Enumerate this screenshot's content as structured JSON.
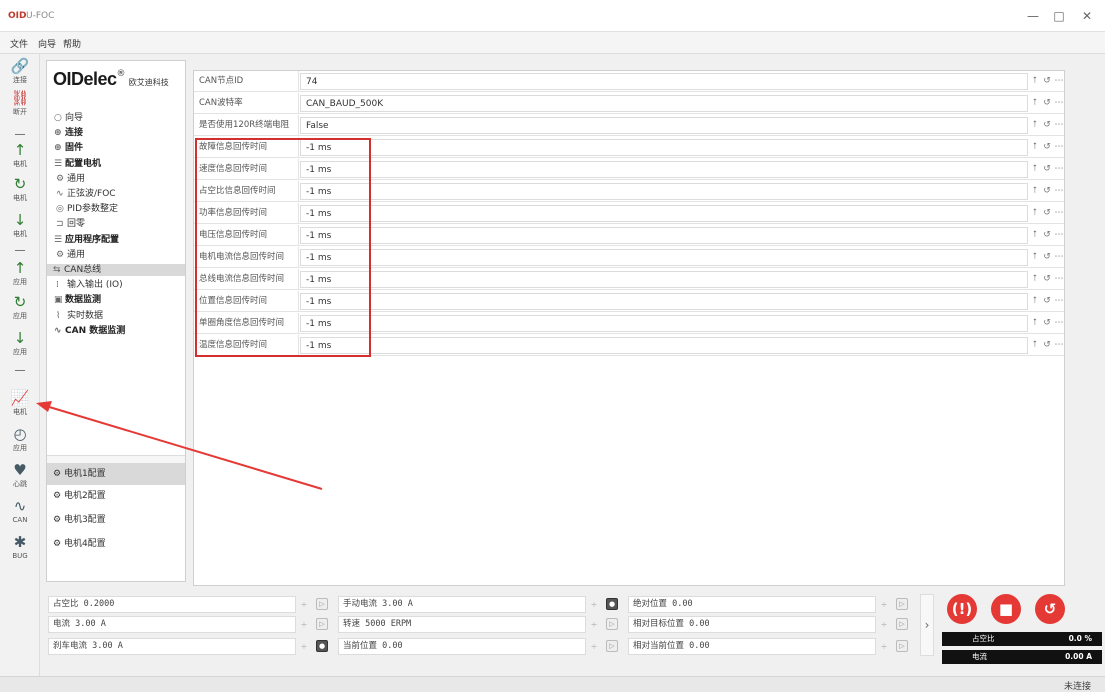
{
  "window": {
    "logo": "OID",
    "title": "U-FOC",
    "minimize": "—",
    "maximize": "□",
    "close": "✕"
  },
  "menu": [
    "文件",
    "向导",
    "帮助"
  ],
  "toolbar": [
    {
      "icon": "link-icon",
      "glyph": "🔗",
      "label": "连接"
    },
    {
      "icon": "unlink-icon",
      "glyph": "⛓",
      "label": "断开"
    },
    {
      "icon": "upload-icon",
      "glyph": "↑",
      "label": "电机"
    },
    {
      "icon": "refresh-icon",
      "glyph": "↻",
      "label": "电机"
    },
    {
      "icon": "download-icon",
      "glyph": "↓",
      "label": "电机"
    },
    {
      "icon": "upload-icon",
      "glyph": "↑",
      "label": "应用"
    },
    {
      "icon": "refresh-icon",
      "glyph": "↻",
      "label": "应用"
    },
    {
      "icon": "download-icon",
      "glyph": "↓",
      "label": "应用"
    },
    {
      "icon": "chart-icon",
      "glyph": "📈",
      "label": "电机"
    },
    {
      "icon": "gauge-icon",
      "glyph": "◴",
      "label": "应用"
    },
    {
      "icon": "heart-icon",
      "glyph": "♥",
      "label": "心跳"
    },
    {
      "icon": "wave-icon",
      "glyph": "∿",
      "label": "CAN"
    },
    {
      "icon": "bug-icon",
      "glyph": "✱",
      "label": "BUG"
    }
  ],
  "brand": {
    "name": "OIDelec",
    "reg": "®",
    "sub": "欧艾迪科技"
  },
  "tree": [
    {
      "label": "向导",
      "icon": "○",
      "bold": false,
      "indent": 0
    },
    {
      "label": "连接",
      "icon": "⊕",
      "bold": true,
      "indent": 0
    },
    {
      "label": "固件",
      "icon": "⊕",
      "bold": true,
      "indent": 0
    },
    {
      "label": "配置电机",
      "icon": "☰",
      "bold": true,
      "indent": 0
    },
    {
      "label": "通用",
      "icon": "⚙",
      "bold": false,
      "indent": 1
    },
    {
      "label": "正弦波/FOC",
      "icon": "∿",
      "bold": false,
      "indent": 1
    },
    {
      "label": "PID参数整定",
      "icon": "◎",
      "bold": false,
      "indent": 1
    },
    {
      "label": "回零",
      "icon": "⊐",
      "bold": false,
      "indent": 1
    },
    {
      "label": "应用程序配置",
      "icon": "☰",
      "bold": true,
      "indent": 0
    },
    {
      "label": "通用",
      "icon": "⚙",
      "bold": false,
      "indent": 1
    },
    {
      "label": "CAN总线",
      "icon": "⇆",
      "bold": false,
      "indent": 1,
      "selected": true
    },
    {
      "label": "输入输出 (IO)",
      "icon": "⁞",
      "bold": false,
      "indent": 1
    },
    {
      "label": "数据监测",
      "icon": "▣",
      "bold": true,
      "indent": 0
    },
    {
      "label": "实时数据",
      "icon": "⌇",
      "bold": false,
      "indent": 1
    },
    {
      "label": "CAN 数据监测",
      "icon": "∿",
      "bold": true,
      "indent": 0
    }
  ],
  "motors": [
    {
      "label": "电机1配置",
      "selected": true
    },
    {
      "label": "电机2配置",
      "selected": false
    },
    {
      "label": "电机3配置",
      "selected": false
    },
    {
      "label": "电机4配置",
      "selected": false
    }
  ],
  "params": [
    {
      "label": "CAN节点ID",
      "value": "74"
    },
    {
      "label": "CAN波特率",
      "value": "CAN_BAUD_500K"
    },
    {
      "label": "是否使用120R终端电阻",
      "value": "False"
    },
    {
      "label": "故障信息回传时间",
      "value": "-1 ms"
    },
    {
      "label": "速度信息回传时间",
      "value": "-1 ms"
    },
    {
      "label": "占空比信息回传时间",
      "value": "-1 ms"
    },
    {
      "label": "功率信息回传时间",
      "value": "-1 ms"
    },
    {
      "label": "电压信息回传时间",
      "value": "-1 ms"
    },
    {
      "label": "电机电流信息回传时间",
      "value": "-1 ms"
    },
    {
      "label": "总线电流信息回传时间",
      "value": "-1 ms"
    },
    {
      "label": "位置信息回传时间",
      "value": "-1 ms"
    },
    {
      "label": "单圈角度信息回传时间",
      "value": "-1 ms"
    },
    {
      "label": "温度信息回传时间",
      "value": "-1 ms"
    }
  ],
  "row_buttons": {
    "up": "⭡",
    "reset": "↺",
    "more": "⋯"
  },
  "controls": [
    {
      "text": "占空比 0.2000",
      "checked": false
    },
    {
      "text": "电流 3.00 A",
      "checked": false
    },
    {
      "text": "刹车电流 3.00 A",
      "checked": true
    },
    {
      "text": "手动电流 3.00 A",
      "checked": true
    },
    {
      "text": "转速 5000 ERPM",
      "checked": false
    },
    {
      "text": "当前位置 0.00",
      "checked": false
    },
    {
      "text": "绝对位置 0.00",
      "checked": false
    },
    {
      "text": "相对目标位置 0.00",
      "checked": false
    },
    {
      "text": "相对当前位置 0.00",
      "checked": false
    }
  ],
  "spin_glyph": "÷",
  "chevron": "›",
  "actions": [
    {
      "name": "fault-button",
      "glyph": "(!)",
      "color": "#e53935"
    },
    {
      "name": "stop-button",
      "glyph": "■",
      "color": "#e53935"
    },
    {
      "name": "reset-button",
      "glyph": "↺",
      "color": "#e53935"
    }
  ],
  "readouts": [
    {
      "label": "占空比",
      "value": "0.0 %",
      "level": 0
    },
    {
      "label": "电流",
      "value": "0.00 A",
      "level": 0
    }
  ],
  "status": "未连接",
  "colors": {
    "highlight": "#d32f2f",
    "accent_green": "#2e7d32",
    "action_red": "#e53935"
  }
}
